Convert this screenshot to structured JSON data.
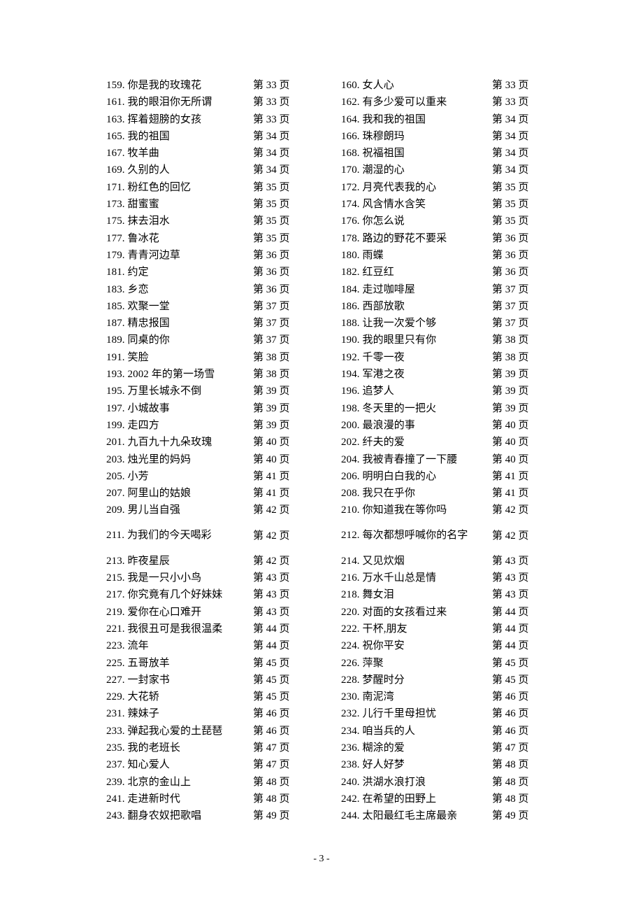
{
  "document": {
    "footer_page_label": "- 3 -"
  },
  "toc": {
    "rows": [
      {
        "tall": false,
        "left": {
          "entry": "159. 你是我的玫瑰花",
          "page": "第 33 页"
        },
        "right": {
          "entry": "160. 女人心",
          "page": "第 33 页"
        }
      },
      {
        "tall": false,
        "left": {
          "entry": "161. 我的眼泪你无所谓",
          "page": "第 33 页"
        },
        "right": {
          "entry": "162. 有多少爱可以重来",
          "page": "第 33 页"
        }
      },
      {
        "tall": false,
        "left": {
          "entry": "163. 挥着翅膀的女孩",
          "page": "第 33 页"
        },
        "right": {
          "entry": "164. 我和我的祖国",
          "page": "第 34 页"
        }
      },
      {
        "tall": false,
        "left": {
          "entry": "165. 我的祖国",
          "page": "第 34 页"
        },
        "right": {
          "entry": "166. 珠穆朗玛",
          "page": "第 34 页"
        }
      },
      {
        "tall": false,
        "left": {
          "entry": "167. 牧羊曲",
          "page": "第 34 页"
        },
        "right": {
          "entry": "168. 祝福祖国",
          "page": "第 34 页"
        }
      },
      {
        "tall": false,
        "left": {
          "entry": "169. 久别的人",
          "page": "第 34 页"
        },
        "right": {
          "entry": "170. 潮湿的心",
          "page": "第 34 页"
        }
      },
      {
        "tall": false,
        "left": {
          "entry": "171. 粉红色的回忆",
          "page": "第 35 页"
        },
        "right": {
          "entry": "172. 月亮代表我的心",
          "page": "第 35 页"
        }
      },
      {
        "tall": false,
        "left": {
          "entry": "173. 甜蜜蜜",
          "page": "第 35 页"
        },
        "right": {
          "entry": "174. 风含情水含笑",
          "page": "第 35 页"
        }
      },
      {
        "tall": false,
        "left": {
          "entry": "175. 抹去泪水",
          "page": "第 35 页"
        },
        "right": {
          "entry": "176. 你怎么说",
          "page": "第 35 页"
        }
      },
      {
        "tall": false,
        "left": {
          "entry": "177. 鲁冰花",
          "page": "第 35 页"
        },
        "right": {
          "entry": "178. 路边的野花不要采",
          "page": "第 36 页"
        }
      },
      {
        "tall": false,
        "left": {
          "entry": "179. 青青河边草",
          "page": "第 36 页"
        },
        "right": {
          "entry": "180. 雨蝶",
          "page": "第 36 页"
        }
      },
      {
        "tall": false,
        "left": {
          "entry": "181. 约定",
          "page": "第 36 页"
        },
        "right": {
          "entry": "182. 红豆红",
          "page": "第 36 页"
        }
      },
      {
        "tall": false,
        "left": {
          "entry": "183. 乡恋",
          "page": "第 36 页"
        },
        "right": {
          "entry": "184. 走过咖啡屋",
          "page": "第 37 页"
        }
      },
      {
        "tall": false,
        "left": {
          "entry": "185. 欢聚一堂",
          "page": "第 37 页"
        },
        "right": {
          "entry": "186. 西部放歌",
          "page": "第 37 页"
        }
      },
      {
        "tall": false,
        "left": {
          "entry": "187. 精忠报国",
          "page": "第 37 页"
        },
        "right": {
          "entry": "188. 让我一次爱个够",
          "page": "第 37 页"
        }
      },
      {
        "tall": false,
        "left": {
          "entry": "189. 同桌的你",
          "page": "第 37 页"
        },
        "right": {
          "entry": "190. 我的眼里只有你",
          "page": "第 38 页"
        }
      },
      {
        "tall": false,
        "left": {
          "entry": "191. 笑脸",
          "page": "第 38 页"
        },
        "right": {
          "entry": "192. 千零一夜",
          "page": "第 38 页"
        }
      },
      {
        "tall": false,
        "left": {
          "entry": "193. 2002 年的第一场雪",
          "page": "第 38 页"
        },
        "right": {
          "entry": "194. 军港之夜",
          "page": "第 39 页"
        }
      },
      {
        "tall": false,
        "left": {
          "entry": "195. 万里长城永不倒",
          "page": "第 39 页"
        },
        "right": {
          "entry": "196. 追梦人",
          "page": "第 39 页"
        }
      },
      {
        "tall": false,
        "left": {
          "entry": "197. 小城故事",
          "page": "第 39 页"
        },
        "right": {
          "entry": "198. 冬天里的一把火",
          "page": "第 39 页"
        }
      },
      {
        "tall": false,
        "left": {
          "entry": "199. 走四方",
          "page": "第 39 页"
        },
        "right": {
          "entry": "200. 最浪漫的事",
          "page": "第 40 页"
        }
      },
      {
        "tall": false,
        "left": {
          "entry": "201. 九百九十九朵玫瑰",
          "page": "第 40 页"
        },
        "right": {
          "entry": "202. 纤夫的爱",
          "page": "第 40 页"
        }
      },
      {
        "tall": false,
        "left": {
          "entry": "203. 烛光里的妈妈",
          "page": "第 40 页"
        },
        "right": {
          "entry": "204. 我被青春撞了一下腰",
          "page": "第 40 页"
        }
      },
      {
        "tall": false,
        "left": {
          "entry": "205. 小芳",
          "page": "第 41 页"
        },
        "right": {
          "entry": "206. 明明白白我的心",
          "page": "第 41 页"
        }
      },
      {
        "tall": false,
        "left": {
          "entry": "207. 阿里山的姑娘",
          "page": "第 41 页"
        },
        "right": {
          "entry": "208. 我只在乎你",
          "page": "第 41 页"
        }
      },
      {
        "tall": false,
        "left": {
          "entry": "209. 男儿当自强",
          "page": "第 42 页"
        },
        "right": {
          "entry": "210. 你知道我在等你吗",
          "page": "第 42 页"
        }
      },
      {
        "tall": true,
        "left": {
          "entry": "211. 为我们的今天喝彩",
          "page": "第 42 页"
        },
        "right": {
          "entry": "212. 每次都想呼喊你的名字",
          "page": "第 42 页"
        }
      },
      {
        "tall": false,
        "left": {
          "entry": "213. 昨夜星辰",
          "page": "第 42 页"
        },
        "right": {
          "entry": "214. 又见炊烟",
          "page": "第 43 页"
        }
      },
      {
        "tall": false,
        "left": {
          "entry": "215. 我是一只小小鸟",
          "page": "第 43 页"
        },
        "right": {
          "entry": "216. 万水千山总是情",
          "page": "第 43 页"
        }
      },
      {
        "tall": false,
        "left": {
          "entry": "217. 你究竟有几个好妹妹",
          "page": "第 43 页"
        },
        "right": {
          "entry": "218. 舞女泪",
          "page": "第 43 页"
        }
      },
      {
        "tall": false,
        "left": {
          "entry": "219. 爱你在心口难开",
          "page": "第 43 页"
        },
        "right": {
          "entry": "220. 对面的女孩看过来",
          "page": "第 44 页"
        }
      },
      {
        "tall": false,
        "left": {
          "entry": "221. 我很丑可是我很温柔",
          "page": "第 44 页"
        },
        "right": {
          "entry": "222. 干杯,朋友",
          "page": "第 44 页"
        }
      },
      {
        "tall": false,
        "left": {
          "entry": "223. 流年",
          "page": "第 44 页"
        },
        "right": {
          "entry": "224. 祝你平安",
          "page": "第 44 页"
        }
      },
      {
        "tall": false,
        "left": {
          "entry": "225. 五哥放羊",
          "page": "第 45 页"
        },
        "right": {
          "entry": "226. 萍聚",
          "page": "第 45 页"
        }
      },
      {
        "tall": false,
        "left": {
          "entry": "227. 一封家书",
          "page": "第 45 页"
        },
        "right": {
          "entry": "228. 梦醒时分",
          "page": "第 45 页"
        }
      },
      {
        "tall": false,
        "left": {
          "entry": "229. 大花轿",
          "page": "第 45 页"
        },
        "right": {
          "entry": "230. 南泥湾",
          "page": "第 46 页"
        }
      },
      {
        "tall": false,
        "left": {
          "entry": "231. 辣妹子",
          "page": "第 46 页"
        },
        "right": {
          "entry": "232. 儿行千里母担忧",
          "page": "第 46 页"
        }
      },
      {
        "tall": false,
        "left": {
          "entry": "233. 弹起我心爱的土琵琶",
          "page": "第 46 页"
        },
        "right": {
          "entry": "234. 咱当兵的人",
          "page": "第 46 页"
        }
      },
      {
        "tall": false,
        "left": {
          "entry": "235. 我的老班长",
          "page": "第 47 页"
        },
        "right": {
          "entry": "236. 糊涂的爱",
          "page": "第 47 页"
        }
      },
      {
        "tall": false,
        "left": {
          "entry": "237. 知心爱人",
          "page": "第 47 页"
        },
        "right": {
          "entry": "238. 好人好梦",
          "page": "第 48 页"
        }
      },
      {
        "tall": false,
        "left": {
          "entry": "239. 北京的金山上",
          "page": "第 48 页"
        },
        "right": {
          "entry": "240. 洪湖水浪打浪",
          "page": "第 48 页"
        }
      },
      {
        "tall": false,
        "left": {
          "entry": "241. 走进新时代",
          "page": "第 48 页"
        },
        "right": {
          "entry": "242. 在希望的田野上",
          "page": "第 48 页"
        }
      },
      {
        "tall": false,
        "left": {
          "entry": "243. 翻身农奴把歌唱",
          "page": "第 49 页"
        },
        "right": {
          "entry": "244. 太阳最红毛主席最亲",
          "page": "第 49 页"
        }
      }
    ]
  }
}
